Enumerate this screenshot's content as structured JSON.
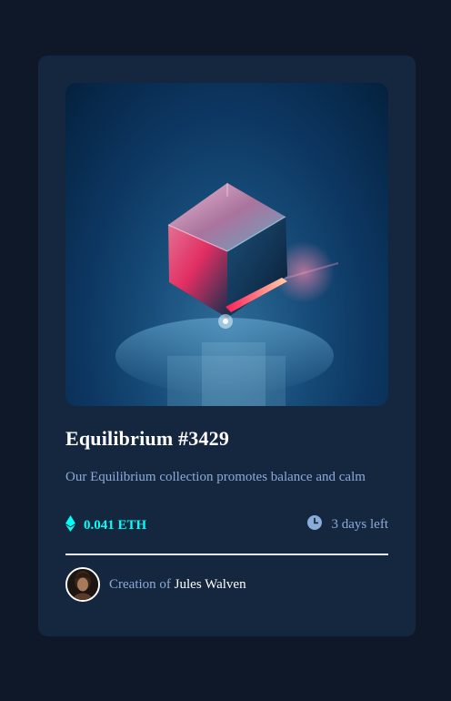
{
  "card": {
    "image": {
      "alt": "Equilibrium",
      "accent": "#ff2d6f"
    },
    "title": "Equilibrium #3429",
    "description": "Our Equilibrium collection promotes balance and calm",
    "price": {
      "icon": "ethereum-icon",
      "value": "0.041 ETH",
      "color": "#00fff8"
    },
    "time_left": {
      "icon": "clock-icon",
      "value": "3 days left"
    },
    "creator": {
      "prefix": "Creation of",
      "name": "Jules Walven",
      "avatar_icon": "avatar"
    }
  },
  "colors": {
    "page_bg": "#0e1829",
    "card_bg": "#15263f",
    "muted_text": "#8bacd9",
    "cyan": "#00fff8",
    "white": "#ffffff"
  }
}
